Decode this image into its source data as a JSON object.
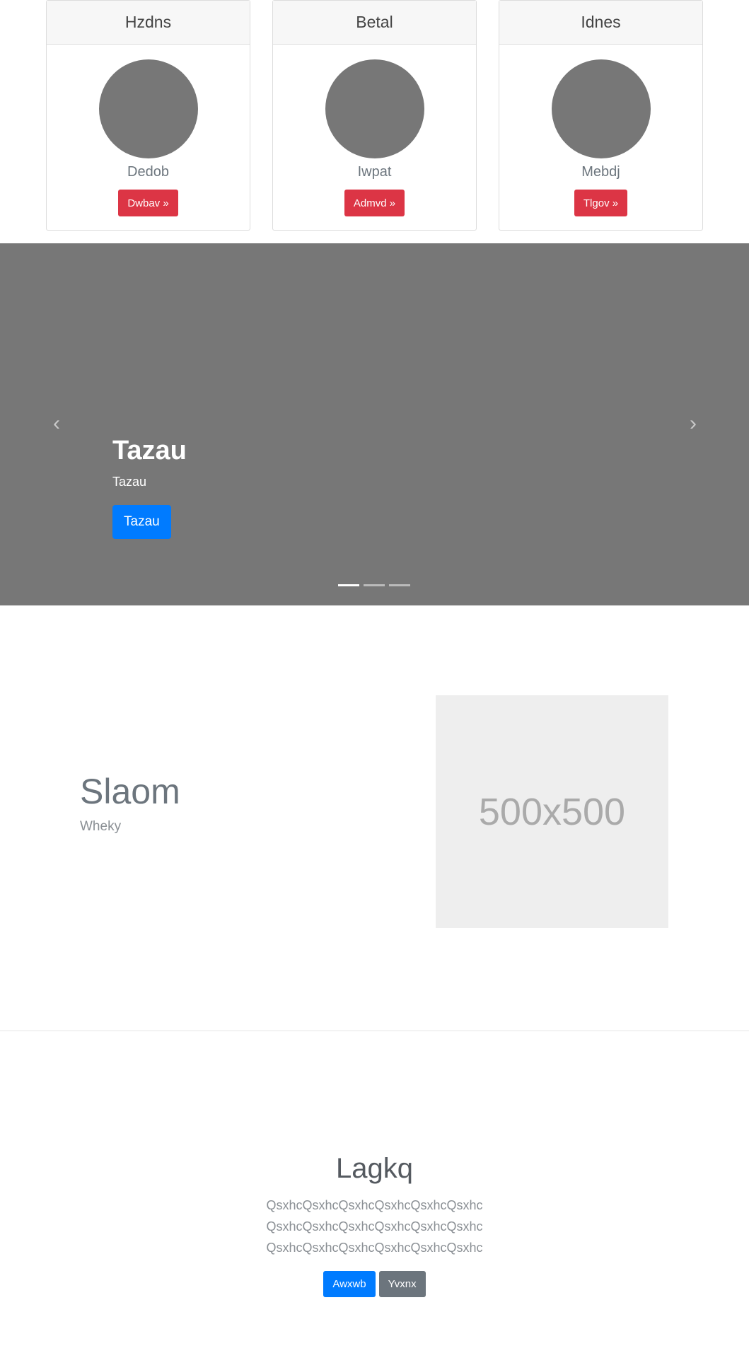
{
  "cards": [
    {
      "title": "Hzdns",
      "subtitle": "Dedob",
      "button": "Dwbav »"
    },
    {
      "title": "Betal",
      "subtitle": "Iwpat",
      "button": "Admvd »"
    },
    {
      "title": "Idnes",
      "subtitle": "Mebdj",
      "button": "Tlgov »"
    }
  ],
  "carousel": {
    "heading": "Tazau",
    "text": "Tazau",
    "button": "Tazau",
    "prev_icon": "‹",
    "next_icon": "›",
    "slide_count": 3,
    "active_slide": 1
  },
  "feature": {
    "title": "Slaom",
    "subtitle": "Wheky",
    "image_label": "500x500"
  },
  "jumbotron": {
    "title": "Lagkq",
    "text": "QsxhcQsxhcQsxhcQsxhcQsxhcQsxhcQsxhcQsxhcQsxhcQsxhcQsxhcQsxhcQsxhcQsxhcQsxhcQsxhcQsxhcQsxhc",
    "primary_button": "Awxwb",
    "secondary_button": "Yvxnx"
  },
  "colors": {
    "danger": "#dc3545",
    "primary": "#007bff",
    "secondary": "#6c757d",
    "carousel_bg": "#777777"
  }
}
